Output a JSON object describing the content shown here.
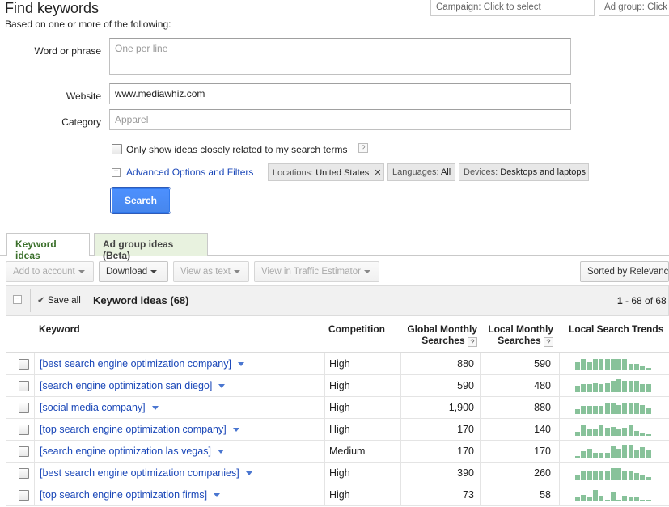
{
  "header": {
    "title": "Find keywords",
    "subtitle": "Based on one or more of the following:",
    "campaign_select": "Campaign: Click to select",
    "adgroup_select": "Ad group: Click to"
  },
  "form": {
    "word_label": "Word or phrase",
    "word_placeholder": "One per line",
    "website_label": "Website",
    "website_value": "www.mediawhiz.com",
    "category_label": "Category",
    "category_placeholder": "Apparel",
    "only_show_label": "Only show ideas closely related to my search terms",
    "help_glyph": "?",
    "advanced_link": "Advanced Options and Filters",
    "chips": {
      "locations_label": "Locations:",
      "locations_value": "United States",
      "languages_label": "Languages:",
      "languages_value": "All",
      "devices_label": "Devices:",
      "devices_value": "Desktops and laptops"
    },
    "search_button": "Search"
  },
  "tabs": [
    {
      "label": "Keyword ideas"
    },
    {
      "label": "Ad group ideas (Beta)"
    }
  ],
  "toolbar": {
    "add_to_account": "Add to account",
    "download": "Download",
    "view_as_text": "View as text",
    "view_in_estimator": "View in Traffic Estimator",
    "sorted_by": "Sorted by Relevance"
  },
  "table": {
    "save_all": "Save all",
    "heading": "Keyword ideas (68)",
    "range_start": "1",
    "range_rest": " - 68 of 68",
    "columns": {
      "keyword": "Keyword",
      "competition": "Competition",
      "global_1": "Global Monthly",
      "global_2": "Searches",
      "local_1": "Local Monthly",
      "local_2": "Searches",
      "trends": "Local Search Trends"
    },
    "rows": [
      {
        "keyword": "[best search engine optimization company]",
        "competition": "High",
        "global": "880",
        "local": "590",
        "trend": [
          0.6,
          0.9,
          0.6,
          0.9,
          0.9,
          0.9,
          0.9,
          0.9,
          0.9,
          0.5,
          0.5,
          0.3,
          0.2
        ]
      },
      {
        "keyword": "[search engine optimization san diego]",
        "competition": "High",
        "global": "590",
        "local": "480",
        "trend": [
          0.5,
          0.6,
          0.6,
          0.7,
          0.6,
          0.7,
          0.9,
          1.0,
          0.9,
          0.9,
          0.9,
          0.6,
          0.6
        ]
      },
      {
        "keyword": "[social media company]",
        "competition": "High",
        "global": "1,900",
        "local": "880",
        "trend": [
          0.4,
          0.6,
          0.6,
          0.6,
          0.6,
          0.8,
          0.9,
          0.7,
          0.8,
          0.8,
          0.9,
          0.7,
          0.5
        ]
      },
      {
        "keyword": "[top search engine optimization company]",
        "competition": "High",
        "global": "170",
        "local": "140",
        "trend": [
          0.3,
          0.8,
          0.5,
          0.5,
          0.8,
          0.6,
          0.7,
          0.5,
          0.6,
          0.9,
          0.4,
          0.2,
          0.1
        ]
      },
      {
        "keyword": "[search engine optimization las vegas]",
        "competition": "Medium",
        "global": "170",
        "local": "170",
        "trend": [
          0.1,
          0.5,
          0.7,
          0.4,
          0.4,
          0.4,
          0.9,
          0.7,
          1.0,
          1.0,
          0.6,
          0.8,
          0.6
        ]
      },
      {
        "keyword": "[best search engine optimization companies]",
        "competition": "High",
        "global": "390",
        "local": "260",
        "trend": [
          0.4,
          0.6,
          0.6,
          0.7,
          0.7,
          0.7,
          0.9,
          0.9,
          0.6,
          0.6,
          0.5,
          0.3,
          0.2
        ]
      },
      {
        "keyword": "[top search engine optimization firms]",
        "competition": "High",
        "global": "73",
        "local": "58",
        "trend": [
          0.3,
          0.5,
          0.3,
          0.9,
          0.4,
          0.1,
          0.7,
          0.1,
          0.4,
          0.3,
          0.3,
          0.1,
          0.1
        ]
      }
    ]
  },
  "colors": {
    "link": "#1a47b8",
    "search_button": "#4d90fe",
    "trend_bar": "#88c29a",
    "active_tab_text": "#3a6f2a",
    "inactive_tab_bg": "#e8f2df"
  }
}
